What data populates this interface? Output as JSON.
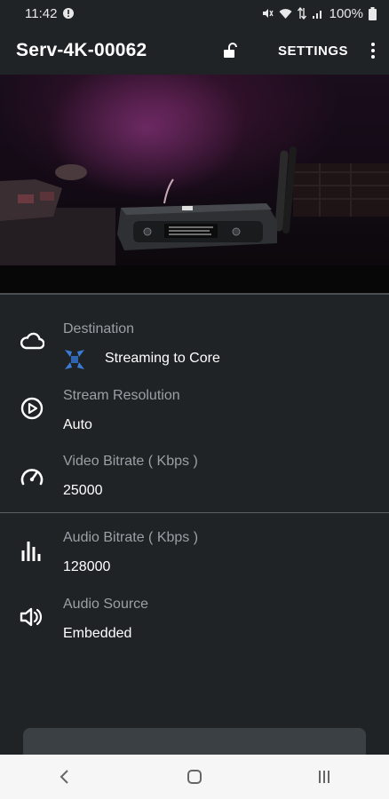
{
  "status_bar": {
    "time": "11:42",
    "battery": "100%"
  },
  "app_bar": {
    "title": "Serv-4K-00062",
    "settings_label": "SETTINGS"
  },
  "items": [
    {
      "label": "Destination",
      "value": "Streaming to Core",
      "icon": "cloud-icon"
    },
    {
      "label": "Stream Resolution",
      "value": "Auto",
      "icon": "play-circle-icon"
    },
    {
      "label": "Video Bitrate ( Kbps )",
      "value": "25000",
      "icon": "speedometer-icon"
    },
    {
      "label": "Audio Bitrate ( Kbps )",
      "value": "128000",
      "icon": "equalizer-icon"
    },
    {
      "label": "Audio Source",
      "value": "Embedded",
      "icon": "speaker-icon"
    }
  ],
  "colors": {
    "background": "#1f2326",
    "label": "#9aa0a5",
    "accent_blue": "#3a7bd5"
  }
}
